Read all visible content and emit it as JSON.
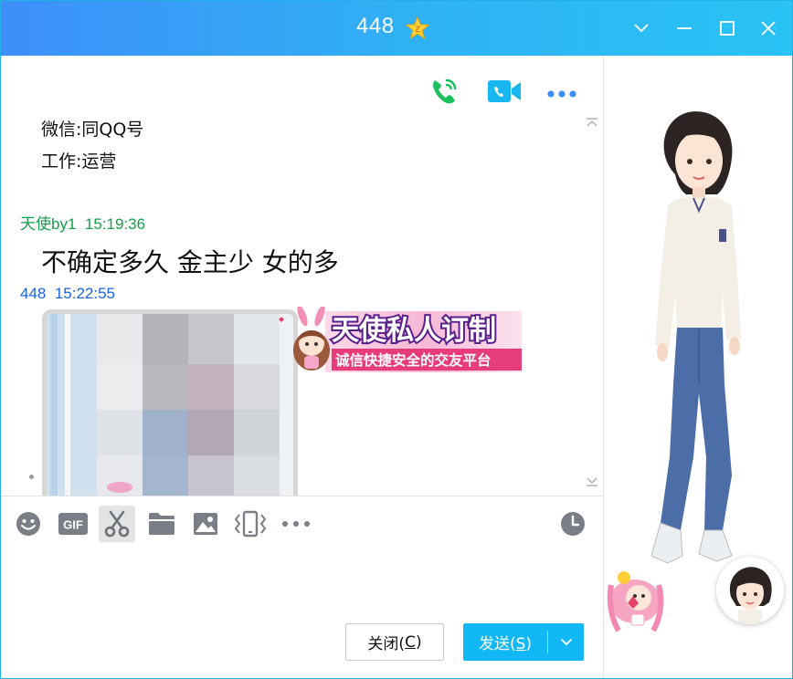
{
  "window": {
    "title": "448",
    "vip_badge_letter": "Z",
    "controls": [
      "chevron-down-icon",
      "minimize-icon",
      "maximize-icon",
      "close-icon"
    ]
  },
  "header_actions": [
    {
      "icon": "phone-call-icon",
      "color": "#19c05c"
    },
    {
      "icon": "video-call-icon",
      "color": "#19b7ef"
    },
    {
      "icon": "more-icon",
      "color": "#3a8ef6"
    }
  ],
  "chat": {
    "profile_lines": [
      {
        "text": "微信:同QQ号"
      },
      {
        "text": "工作:运营"
      }
    ],
    "messages": [
      {
        "sender": "天使by1",
        "time": "15:19:36",
        "sender_color": "#12a04a",
        "text": "不确定多久 金主少 女的多"
      },
      {
        "sender": "448",
        "time": "15:22:55",
        "sender_color": "#1b62e0",
        "attachment": "blurred-photo",
        "sticker_title": "天使私人订制",
        "sticker_subtitle": "诚信快捷安全的交友平台"
      }
    ]
  },
  "toolbar": {
    "tools": [
      "emoji-icon",
      "gif-icon",
      "scissors-icon",
      "folder-icon",
      "image-icon",
      "shake-icon",
      "more-icon",
      "history-clock-icon"
    ],
    "gif_label": "GIF"
  },
  "buttons": {
    "close_label": "关闭(",
    "close_key": "C",
    "close_suffix": ")",
    "send_label": "发送(",
    "send_key": "S",
    "send_suffix": ")"
  },
  "colors": {
    "titlebar_start": "#3d8ff8",
    "titlebar_end": "#29c3f4",
    "send_button": "#12b7f5"
  }
}
